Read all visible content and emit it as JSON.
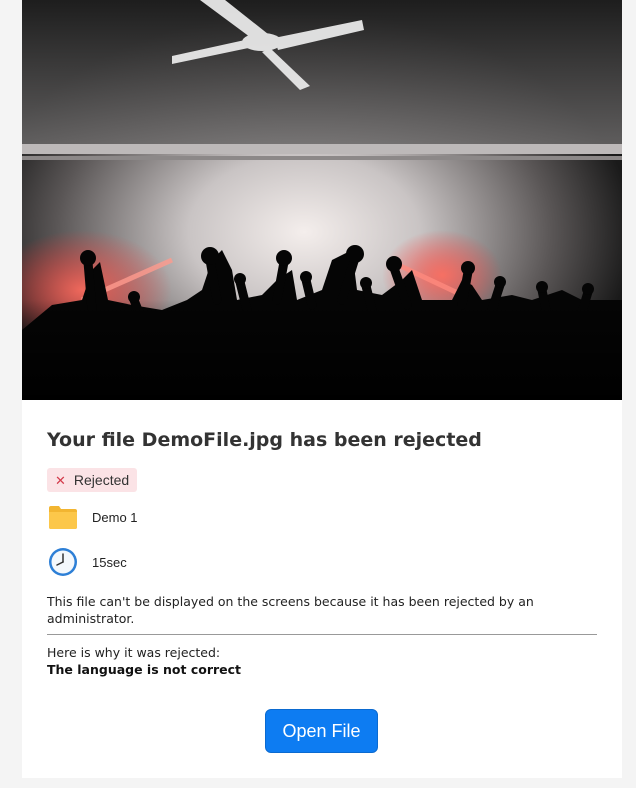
{
  "hero": {
    "image_icon": "concert-crowd-photo"
  },
  "file": {
    "title": "Your file DemoFile.jpg has been rejected",
    "status": {
      "label": "Rejected",
      "icon": "close-icon",
      "color": "#d33a4a",
      "background": "#fbe3e6"
    },
    "folder": {
      "icon": "folder-icon",
      "name": "Demo 1"
    },
    "duration": {
      "icon": "clock-icon",
      "value": "15sec"
    },
    "description": "This file can't be displayed on the screens because it has been rejected by an administrator.",
    "reason_label": "Here is why it was rejected:",
    "reason": "The language is not correct"
  },
  "actions": {
    "open_label": "Open File",
    "accent": "#0d7cf2"
  }
}
